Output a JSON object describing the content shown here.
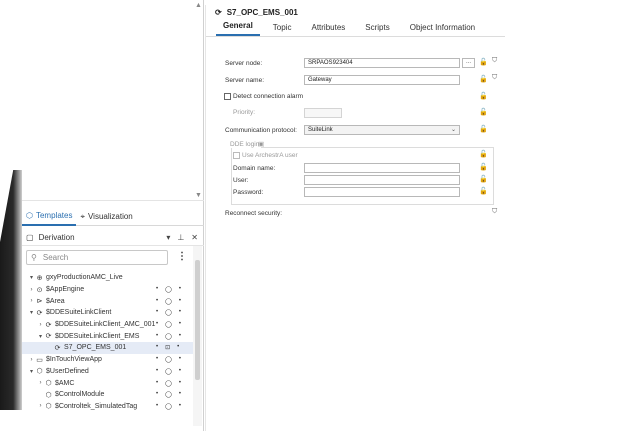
{
  "left": {
    "bottom_tabs": [
      {
        "label": "Templates",
        "icon": "templates-icon",
        "active": true
      },
      {
        "label": "Visualization",
        "icon": "visualization-icon",
        "active": false
      }
    ],
    "derivation": {
      "title": "Derivation",
      "search_placeholder": "Search",
      "tree": [
        {
          "label": "gxyProductionAMC_Live",
          "icon": "galaxy-icon",
          "indent": 1,
          "arrow": "▾",
          "flags": false
        },
        {
          "label": "$AppEngine",
          "icon": "appengine-icon",
          "indent": 1,
          "arrow": "›",
          "flags": true
        },
        {
          "label": "$Area",
          "icon": "area-icon",
          "indent": 1,
          "arrow": "›",
          "flags": true
        },
        {
          "label": "$DDESuiteLinkClient",
          "icon": "client-icon",
          "indent": 1,
          "arrow": "▾",
          "flags": true
        },
        {
          "label": "$DDESuiteLinkClient_AMC_001",
          "icon": "client-icon",
          "indent": 2,
          "arrow": "›",
          "flags": true
        },
        {
          "label": "$DDESuiteLinkClient_EMS",
          "icon": "client-icon",
          "indent": 2,
          "arrow": "▾",
          "flags": true
        },
        {
          "label": "S7_OPC_EMS_001",
          "icon": "client-icon",
          "indent": 3,
          "arrow": "",
          "flags": true,
          "selected": true
        },
        {
          "label": "$InTouchViewApp",
          "icon": "monitor-icon",
          "indent": 1,
          "arrow": "›",
          "flags": true
        },
        {
          "label": "$UserDefined",
          "icon": "userdefined-icon",
          "indent": 1,
          "arrow": "▾",
          "flags": true
        },
        {
          "label": "$AMC",
          "icon": "userdefined-icon",
          "indent": 2,
          "arrow": "›",
          "flags": true
        },
        {
          "label": "$ControlModule",
          "icon": "userdefined-icon",
          "indent": 2,
          "arrow": "",
          "flags": true
        },
        {
          "label": "$Controltek_SimulatedTag",
          "icon": "userdefined-icon",
          "indent": 2,
          "arrow": "›",
          "flags": true
        }
      ]
    }
  },
  "editor": {
    "title": "S7_OPC_EMS_001",
    "tabs": [
      "General",
      "Topic",
      "Attributes",
      "Scripts",
      "Object Information"
    ],
    "active_tab": "General",
    "server_node_label": "Server node:",
    "server_node_value": "SRPAOS923404",
    "server_name_label": "Server name:",
    "server_name_value": "Gateway",
    "detect_alarm_label": "Detect connection alarm",
    "priority_label": "Priority:",
    "comm_protocol_label": "Communication protocol:",
    "comm_protocol_value": "SuiteLink",
    "dde_login_label": "DDE login",
    "use_archestra_label": "Use ArchestrA user",
    "domain_label": "Domain name:",
    "user_label": "User:",
    "password_label": "Password:",
    "reconnect_label": "Reconnect security:"
  },
  "colors": {
    "accent": "#2a6fb0",
    "selected_row": "#e5ebf6"
  }
}
